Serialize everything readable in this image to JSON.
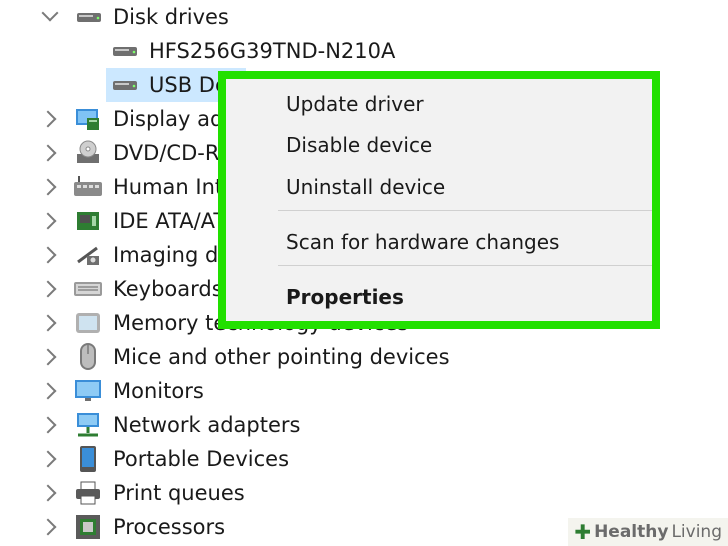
{
  "tree": {
    "disk_drives": {
      "label": "Disk drives",
      "icon": "disk-drive-icon"
    },
    "disk_children": [
      {
        "label": "HFS256G39TND-N210A",
        "icon": "disk-drive-icon"
      },
      {
        "label": "USB De",
        "icon": "disk-drive-icon",
        "selected": true
      }
    ],
    "categories": [
      {
        "label": "Display ad",
        "icon": "display-adapter-icon"
      },
      {
        "label": "DVD/CD-R",
        "icon": "dvd-drive-icon"
      },
      {
        "label": "Human Int",
        "icon": "human-interface-icon"
      },
      {
        "label": "IDE ATA/AT",
        "icon": "ide-controller-icon"
      },
      {
        "label": "Imaging d",
        "icon": "camera-icon"
      },
      {
        "label": "Keyboards",
        "icon": "keyboard-icon"
      },
      {
        "label": "Memory technology devices",
        "icon": "memory-icon"
      },
      {
        "label": "Mice and other pointing devices",
        "icon": "mouse-icon"
      },
      {
        "label": "Monitors",
        "icon": "monitor-icon"
      },
      {
        "label": "Network adapters",
        "icon": "network-icon"
      },
      {
        "label": "Portable Devices",
        "icon": "portable-device-icon"
      },
      {
        "label": "Print queues",
        "icon": "printer-icon"
      },
      {
        "label": "Processors",
        "icon": "processor-icon"
      }
    ]
  },
  "context_menu": {
    "items": [
      {
        "label": "Update driver"
      },
      {
        "label": "Disable device"
      },
      {
        "label": "Uninstall device"
      },
      {
        "label": "Scan for hardware changes"
      },
      {
        "label": "Properties"
      }
    ],
    "highlight_color": "#22e000"
  },
  "watermark": {
    "brand": "Healthy",
    "brand2": "Living"
  }
}
